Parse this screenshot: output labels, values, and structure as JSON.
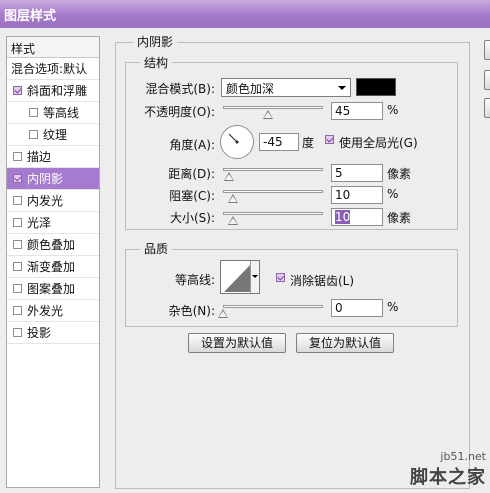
{
  "title": "图层样式",
  "left_panel": {
    "header": "样式",
    "blend_options": "混合选项:默认",
    "items": [
      {
        "label": "斜面和浮雕",
        "checked": true,
        "indent": false,
        "selected": false
      },
      {
        "label": "等高线",
        "checked": false,
        "indent": true,
        "selected": false
      },
      {
        "label": "纹理",
        "checked": false,
        "indent": true,
        "selected": false
      },
      {
        "label": "描边",
        "checked": false,
        "indent": false,
        "selected": false
      },
      {
        "label": "内阴影",
        "checked": true,
        "indent": false,
        "selected": true
      },
      {
        "label": "内发光",
        "checked": false,
        "indent": false,
        "selected": false
      },
      {
        "label": "光泽",
        "checked": false,
        "indent": false,
        "selected": false
      },
      {
        "label": "颜色叠加",
        "checked": false,
        "indent": false,
        "selected": false
      },
      {
        "label": "渐变叠加",
        "checked": false,
        "indent": false,
        "selected": false
      },
      {
        "label": "图案叠加",
        "checked": false,
        "indent": false,
        "selected": false
      },
      {
        "label": "外发光",
        "checked": false,
        "indent": false,
        "selected": false
      },
      {
        "label": "投影",
        "checked": false,
        "indent": false,
        "selected": false
      }
    ]
  },
  "inner_shadow": {
    "group_title": "内阴影",
    "structure": {
      "title": "结构",
      "blend_mode_label": "混合模式(B):",
      "blend_mode_value": "颜色加深",
      "shadow_color": "#000000",
      "opacity_label": "不透明度(O):",
      "opacity_value": "45",
      "opacity_fraction": 0.45,
      "opacity_unit": "%",
      "angle_label": "角度(A):",
      "angle_value": "-45",
      "angle_unit": "度",
      "global_light_label": "使用全局光(G)",
      "global_light_checked": true,
      "distance_label": "距离(D):",
      "distance_value": "5",
      "distance_unit": "像素",
      "choke_label": "阻塞(C):",
      "choke_value": "10",
      "choke_unit": "%",
      "size_label": "大小(S):",
      "size_value": "10",
      "size_unit": "像素"
    },
    "quality": {
      "title": "品质",
      "contour_label": "等高线:",
      "anti_alias_label": "消除锯齿(L)",
      "anti_alias_checked": true,
      "noise_label": "杂色(N):",
      "noise_value": "0",
      "noise_unit": "%"
    },
    "buttons": {
      "set_default": "设置为默认值",
      "reset_default": "复位为默认值"
    }
  },
  "watermark": {
    "url": "jb51.net",
    "site": "脚本之家"
  },
  "colors": {
    "title_bar": "#a57ac9",
    "selected_item": "#a67ad0",
    "shadow_swatch": "#000000"
  }
}
